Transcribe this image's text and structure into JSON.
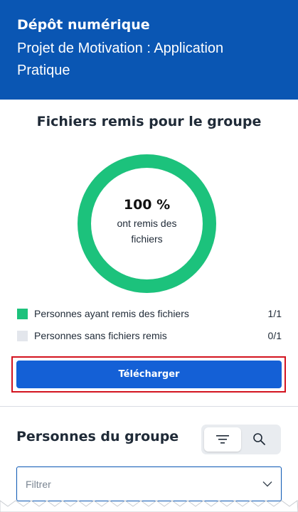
{
  "header": {
    "title": "Dépôt numérique",
    "subtitle": "Projet de Motivation : Application Pratique"
  },
  "submissions": {
    "title": "Fichiers remis pour le groupe",
    "donut": {
      "percent_label": "100 %",
      "description": "ont remis des fichiers",
      "fraction_submitted": 1.0,
      "color_submitted": "#1cc27c",
      "color_not_submitted": "#e3e6ec"
    },
    "legend": [
      {
        "label": "Personnes ayant remis des fichiers",
        "count": "1/1",
        "color": "#1cc27c"
      },
      {
        "label": "Personnes sans fichiers remis",
        "count": "0/1",
        "color": "#e3e6ec"
      }
    ],
    "download_label": "Télécharger"
  },
  "members": {
    "title": "Personnes du groupe",
    "filter_icon": "filter-lines-icon",
    "search_icon": "magnifier-icon",
    "filter_placeholder": "Filtrer",
    "chevron_icon": "chevron-down-icon"
  },
  "colors": {
    "header_bg": "#0a56b3",
    "button_bg": "#1460d6",
    "highlight": "#d3131f"
  }
}
